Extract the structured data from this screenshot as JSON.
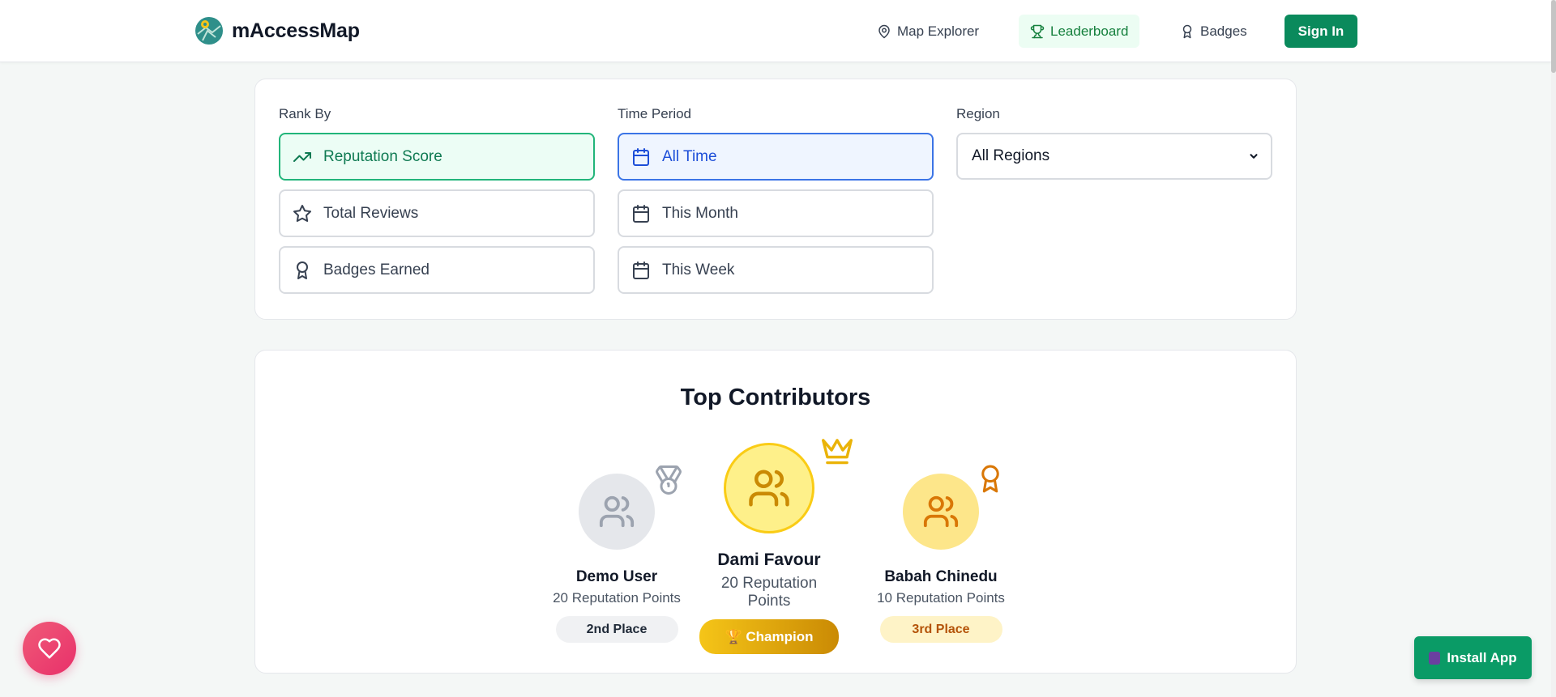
{
  "header": {
    "brand": "mAccessMap",
    "nav": [
      {
        "label": "Map Explorer",
        "icon": "map-pin-icon"
      },
      {
        "label": "Leaderboard",
        "icon": "trophy-icon",
        "active": true
      },
      {
        "label": "Badges",
        "icon": "award-icon"
      }
    ],
    "signin_label": "Sign In"
  },
  "filters": {
    "rank_by": {
      "label": "Rank By",
      "options": [
        {
          "label": "Reputation Score",
          "icon": "trending-up-icon",
          "selected": true
        },
        {
          "label": "Total Reviews",
          "icon": "star-icon",
          "selected": false
        },
        {
          "label": "Badges Earned",
          "icon": "award-icon",
          "selected": false
        }
      ]
    },
    "time_period": {
      "label": "Time Period",
      "options": [
        {
          "label": "All Time",
          "icon": "calendar-icon",
          "selected": true
        },
        {
          "label": "This Month",
          "icon": "calendar-icon",
          "selected": false
        },
        {
          "label": "This Week",
          "icon": "calendar-icon",
          "selected": false
        }
      ]
    },
    "region": {
      "label": "Region",
      "selected": "All Regions"
    }
  },
  "top_contributors": {
    "title": "Top Contributors",
    "podium": [
      {
        "name": "Demo User",
        "points": "20 Reputation Points",
        "badge": "2nd Place",
        "icon": "medal-icon"
      },
      {
        "name": "Dami Favour",
        "points": "20 Reputation Points",
        "badge": "🏆 Champion",
        "icon": "crown-icon"
      },
      {
        "name": "Babah Chinedu",
        "points": "10 Reputation Points",
        "badge": "3rd Place",
        "icon": "award-icon"
      }
    ]
  },
  "install_label": "Install App",
  "colors": {
    "brand_green": "#0a8a5c",
    "gold": "#eab308",
    "silver": "#9ca3af",
    "bronze": "#d97706"
  }
}
